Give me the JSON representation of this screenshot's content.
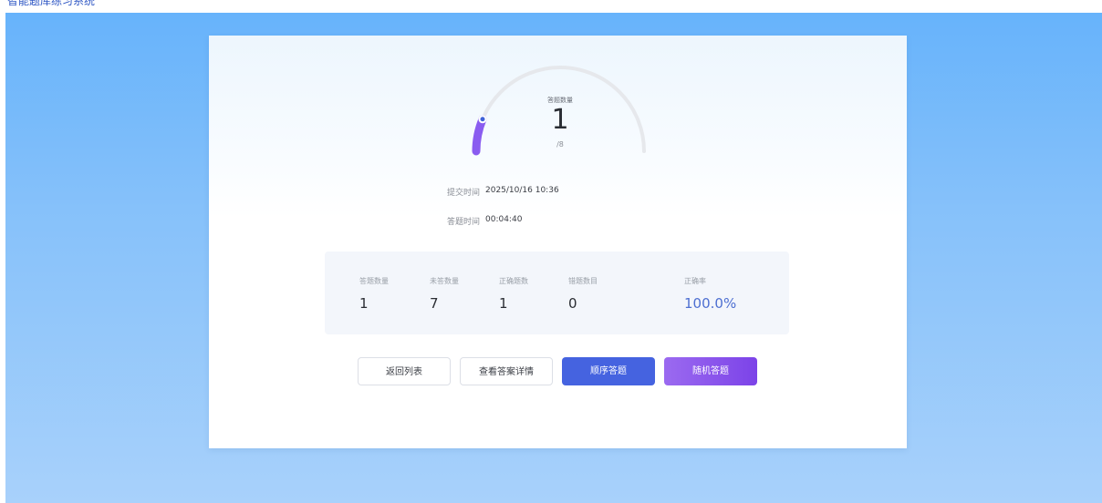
{
  "header": {
    "title": "智能题库练习系统"
  },
  "gauge": {
    "label": "答题数量",
    "value": "1",
    "total": "/8",
    "answered": 1,
    "total_count": 8,
    "track_color": "#e6e8ec",
    "progress_color": "#8a5cf0",
    "knob_color": "#3f62d8"
  },
  "info": {
    "submit_label": "提交时间",
    "submit_value": "2025/10/16 10:36",
    "duration_label": "答题时间",
    "duration_value": "00:04:40"
  },
  "stats": {
    "answered_label": "答题数量",
    "answered_value": "1",
    "unanswered_label": "未答数量",
    "unanswered_value": "7",
    "correct_label": "正确题数",
    "correct_value": "1",
    "wrong_label": "错题数目",
    "wrong_value": "0",
    "accuracy_label": "正确率",
    "accuracy_value": "100.0%",
    "accuracy_color": "#4d6fd1"
  },
  "buttons": {
    "back_list": "返回列表",
    "view_details": "查看答案详情",
    "sequential": "顺序答题",
    "random": "随机答题"
  },
  "colors": {
    "primary": "#4563e0",
    "purple_start": "#9b6af0",
    "purple_end": "#7c43e8",
    "background_top": "#67b3fb"
  }
}
